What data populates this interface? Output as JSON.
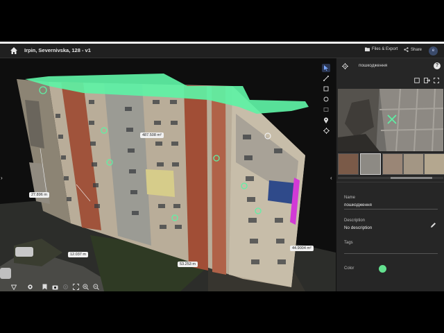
{
  "header": {
    "title": "Irpin, Severnivska, 128 - v1",
    "files_export": "Files & Export",
    "share": "Share",
    "avatar_initial": "e"
  },
  "viewport": {
    "measurements": [
      {
        "id": "area",
        "text": "487.508 m²"
      },
      {
        "id": "left-height",
        "text": "27.896 m"
      },
      {
        "id": "bottom-left",
        "text": "12.037 m"
      },
      {
        "id": "bottom-mid",
        "text": "53.253 m"
      },
      {
        "id": "right-height",
        "text": "44.9004 m²"
      }
    ]
  },
  "panel": {
    "title": "пошкодження",
    "name_label": "Name",
    "name_value": "пошкодження",
    "description_label": "Description",
    "description_value": "No description",
    "tags_label": "Tags",
    "color_label": "Color",
    "color_value": "#63e08f"
  },
  "colors": {
    "accent": "#7aa7ff",
    "highlight_green": "#5ef2a5",
    "highlight_magenta": "#d23ad6"
  }
}
